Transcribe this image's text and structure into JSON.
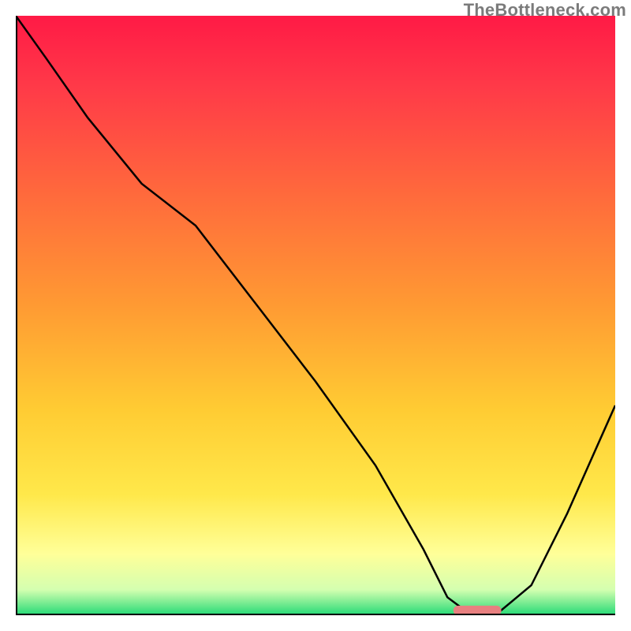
{
  "watermark": "TheBottleneck.com",
  "colors": {
    "curve_stroke": "#000000",
    "marker_fill": "#e88080",
    "gradient_stops": [
      {
        "offset": "0%",
        "color": "#ff1a46"
      },
      {
        "offset": "12%",
        "color": "#ff3a48"
      },
      {
        "offset": "30%",
        "color": "#ff6a3c"
      },
      {
        "offset": "48%",
        "color": "#ff9933"
      },
      {
        "offset": "66%",
        "color": "#ffcc33"
      },
      {
        "offset": "80%",
        "color": "#ffe84a"
      },
      {
        "offset": "90%",
        "color": "#ffff99"
      },
      {
        "offset": "96%",
        "color": "#d4ffb0"
      },
      {
        "offset": "100%",
        "color": "#2fdc79"
      }
    ]
  },
  "chart_data": {
    "type": "line",
    "title": "",
    "xlabel": "",
    "ylabel": "",
    "xlim": [
      0,
      100
    ],
    "ylim": [
      0,
      100
    ],
    "grid": false,
    "legend": false,
    "x": [
      0,
      5,
      12,
      21,
      30,
      40,
      50,
      60,
      68,
      72,
      76,
      80,
      86,
      92,
      100
    ],
    "values": [
      100,
      93,
      83,
      72,
      65,
      52,
      39,
      25,
      11,
      3,
      0,
      0,
      5,
      17,
      35
    ],
    "marker": {
      "x_start": 73,
      "x_end": 81,
      "y": 0,
      "thickness_pct": 1.6
    }
  }
}
